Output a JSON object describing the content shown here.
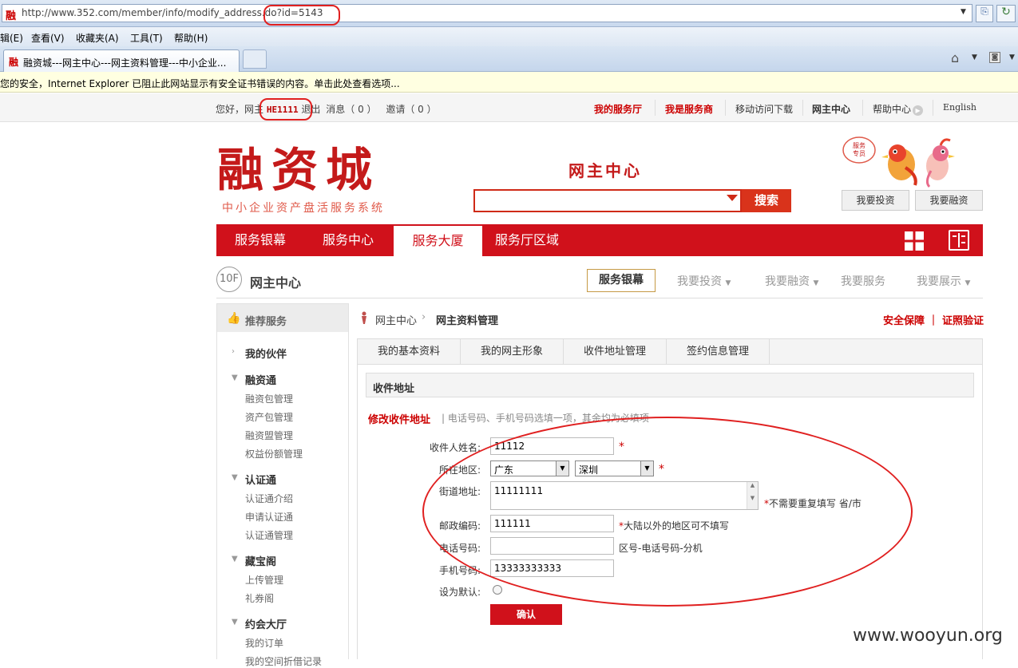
{
  "browser": {
    "url": "http://www.352.com/member/info/modify_address.do?id=5143",
    "favicon": "融",
    "menu": [
      "辑(E)",
      "查看(V)",
      "收藏夹(A)",
      "工具(T)",
      "帮助(H)"
    ],
    "tab_icon": "融",
    "tab_title": "融资城---网主中心---网主资料管理---中小企业...",
    "infobar": "您的安全，Internet Explorer 已阻止此网站显示有安全证书错误的内容。单击此处查看选项..."
  },
  "topbar": {
    "hello": "您好，网主",
    "username": "HE1111",
    "logout": "退出",
    "messages": "消息（ 0 ）",
    "invites": "邀请（ 0 ）",
    "links": [
      "我的服务厅",
      "我是服务商",
      "移动访问下载",
      "网主中心",
      "帮助中心",
      "English"
    ]
  },
  "header": {
    "logo": "融资城",
    "logo_sub": "中小企业资产盘活服务系统",
    "center_title": "网主中心",
    "search_btn": "搜索",
    "mascot_badge": "服务专员",
    "btn_invest": "我要投资",
    "btn_finance": "我要融资"
  },
  "mainnav": [
    "服务银幕",
    "服务中心",
    "服务大厦",
    "服务厅区域"
  ],
  "floor": {
    "badge": "10F",
    "title": "网主中心",
    "active": "服务银幕",
    "links": [
      "我要投资",
      "我要融资",
      "我要服务",
      "我要展示"
    ]
  },
  "sidebar": {
    "head": "推荐服务",
    "groups": [
      {
        "label": "我的伙伴",
        "items": []
      },
      {
        "label": "融资通",
        "items": [
          "融资包管理",
          "资产包管理",
          "融资盟管理",
          "权益份额管理"
        ]
      },
      {
        "label": "认证通",
        "items": [
          "认证通介绍",
          "申请认证通",
          "认证通管理"
        ]
      },
      {
        "label": "藏宝阁",
        "items": [
          "上传管理",
          "礼券阁"
        ]
      },
      {
        "label": "约会大厅",
        "items": [
          "我的订单",
          "我的空间折借记录"
        ]
      }
    ]
  },
  "breadcrumb": {
    "home": "网主中心",
    "current": "网主资料管理",
    "right": "安全保障 ｜ 证照验证"
  },
  "subtabs": [
    "我的基本资料",
    "我的网主形象",
    "收件地址管理",
    "签约信息管理"
  ],
  "section": {
    "title": "收件地址"
  },
  "form": {
    "edit_title": "修改收件地址",
    "edit_note": "| 电话号码、手机号码选填一项，其余均为必填项",
    "name_label": "收件人姓名:",
    "name_value": "11112",
    "region_label": "所在地区:",
    "province": "广东",
    "city": "深圳",
    "street_label": "街道地址:",
    "street_value": "11111111",
    "street_note": "不需要重复填写 省/市",
    "zip_label": "邮政编码:",
    "zip_value": "111111",
    "zip_note": "大陆以外的地区可不填写",
    "phone_label": "电话号码:",
    "phone_value": "",
    "phone_note": "区号-电话号码-分机",
    "mobile_label": "手机号码:",
    "mobile_value": "13333333333",
    "default_label": "设为默认:",
    "confirm": "确认",
    "required_mark": "*"
  },
  "watermark": "www.wooyun.org",
  "colors": {
    "brand_red": "#d0111b",
    "annotation_red": "#e02020"
  }
}
